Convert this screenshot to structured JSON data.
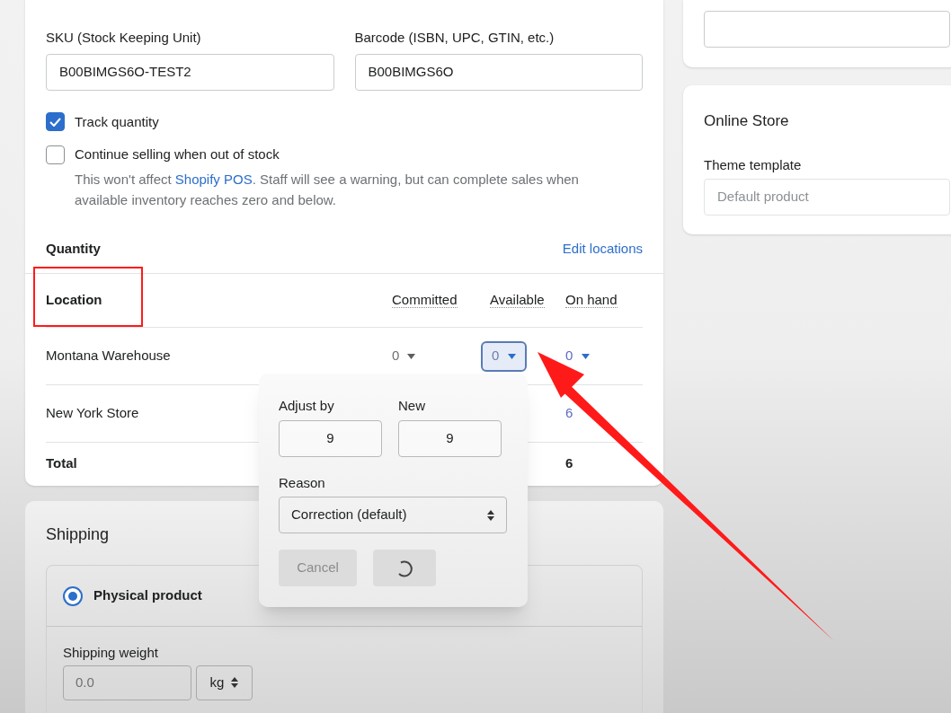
{
  "inventory": {
    "sku": {
      "label": "SKU (Stock Keeping Unit)",
      "value": "B00BIMGS6O-TEST2"
    },
    "barcode": {
      "label": "Barcode (ISBN, UPC, GTIN, etc.)",
      "value": "B00BIMGS6O"
    },
    "track_quantity": {
      "label": "Track quantity",
      "checked": true
    },
    "continue_selling": {
      "label": "Continue selling when out of stock",
      "checked": false,
      "help_before": "This won't affect ",
      "help_link": "Shopify POS",
      "help_after": ". Staff will see a warning, but can complete sales when available inventory reaches zero and below."
    }
  },
  "quantity": {
    "title": "Quantity",
    "edit_link": "Edit locations",
    "columns": [
      "Location",
      "Committed",
      "Available",
      "On hand"
    ],
    "rows": [
      {
        "location": "Montana Warehouse",
        "committed": "0",
        "available": "0",
        "available_focused": true,
        "on_hand": "0"
      },
      {
        "location": "New York Store",
        "on_hand": "6"
      }
    ],
    "total": {
      "label": "Total",
      "on_hand": "6"
    }
  },
  "adjust_popover": {
    "adjust_by": {
      "label": "Adjust by",
      "value": "9"
    },
    "new": {
      "label": "New",
      "value": "9"
    },
    "reason": {
      "label": "Reason",
      "value": "Correction (default)"
    },
    "cancel": "Cancel",
    "save_loading": true
  },
  "shipping": {
    "title": "Shipping",
    "physical_product": {
      "label": "Physical product",
      "selected": true
    },
    "weight": {
      "label": "Shipping weight",
      "placeholder": "0.0",
      "unit": "kg"
    }
  },
  "online_store": {
    "title": "Online Store",
    "theme_template": {
      "label": "Theme template",
      "placeholder": "Default product"
    }
  }
}
